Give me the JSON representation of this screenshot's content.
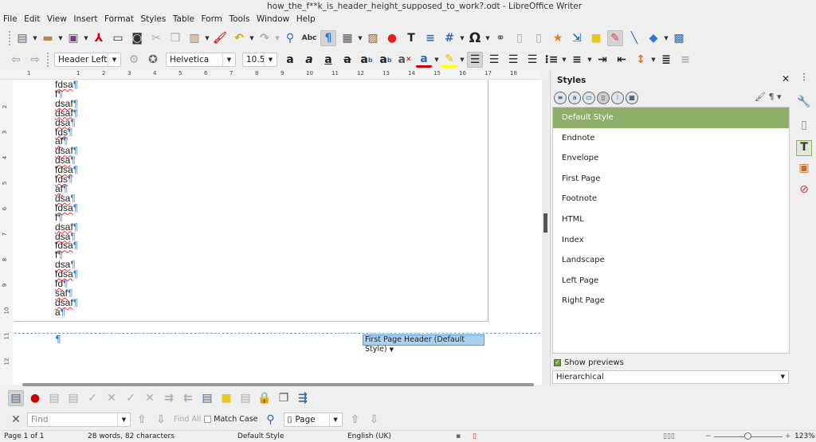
{
  "window": {
    "title": "how_the_f**k_is_header_height_supposed_to_work?.odt - LibreOffice Writer"
  },
  "menu": [
    "File",
    "Edit",
    "View",
    "Insert",
    "Format",
    "Styles",
    "Table",
    "Form",
    "Tools",
    "Window",
    "Help"
  ],
  "formatting": {
    "paragraph_style": "Header Left",
    "font_name": "Helvetica",
    "font_size": "10.5"
  },
  "ruler": {
    "h_ticks": [
      "1",
      "1",
      "2",
      "3",
      "4",
      "5",
      "6",
      "7",
      "8",
      "9",
      "10",
      "11",
      "12",
      "13",
      "14",
      "15",
      "16",
      "17",
      "18"
    ],
    "v_ticks": [
      "2",
      "3",
      "4",
      "5",
      "6",
      "7",
      "8",
      "9",
      "10",
      "11",
      "12"
    ]
  },
  "document": {
    "lines": [
      "fdsa",
      "f",
      "dsaf",
      "dsaf",
      "dsa",
      "fds",
      "af",
      "dsaf",
      "dsa",
      "fdsa",
      "fds",
      "af",
      "dsa",
      "fdsa",
      "f",
      "dsaf",
      "dsa",
      "fdsa",
      "f",
      "dsa",
      "fdsa",
      "fd",
      "saf",
      "dsaf",
      "a"
    ],
    "pilcrow": "¶",
    "header_button": "First Page Header (Default Style)"
  },
  "sidebar": {
    "title": "Styles",
    "styles": [
      "Default Style",
      "Endnote",
      "Envelope",
      "First Page",
      "Footnote",
      "HTML",
      "Index",
      "Landscape",
      "Left Page",
      "Right Page"
    ],
    "selected": "Default Style",
    "show_previews_label": "Show previews",
    "show_previews": true,
    "filter": "Hierarchical",
    "accent": "#8fae6a"
  },
  "find": {
    "placeholder": "Find",
    "find_all": "Find All",
    "match_case": "Match Case",
    "search_by": "Page"
  },
  "status": {
    "page": "Page 1 of 1",
    "words": "28 words, 82 characters",
    "page_style": "Default Style",
    "language": "English (UK)",
    "zoom": "123%",
    "zoom_level": 123
  }
}
